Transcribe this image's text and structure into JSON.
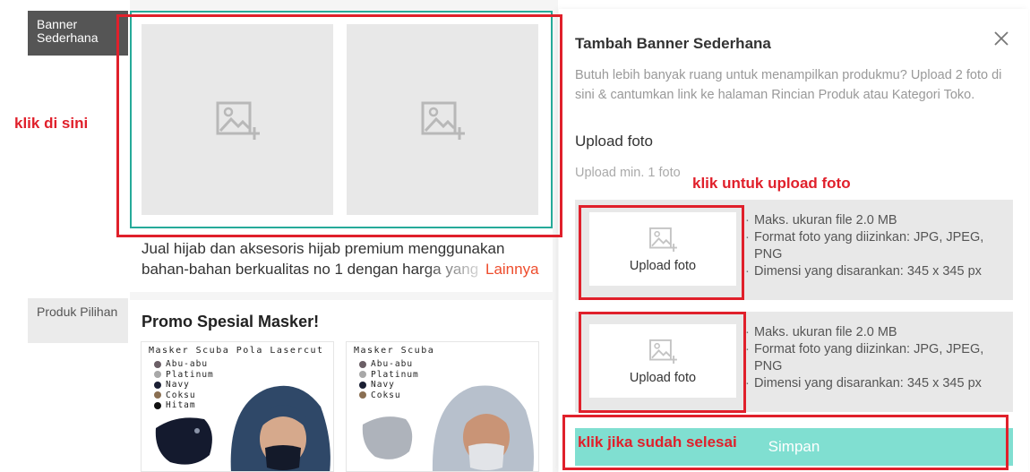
{
  "editor": {
    "tab_banner": "Banner Sederhana",
    "tab_produk": "Produk Pilihan",
    "description": "Jual hijab dan aksesoris hijab premium menggunakan bahan-bahan berkualitas no 1 dengan harga yang",
    "more_link": "Lainnya",
    "promo_title": "Promo Spesial Masker!",
    "products": [
      {
        "name": "Masker Scuba Pola Lasercut",
        "colors": [
          {
            "label": "Abu-abu",
            "hex": "#6b5f66"
          },
          {
            "label": "Platinum",
            "hex": "#a8a8a8"
          },
          {
            "label": "Navy",
            "hex": "#1b2034"
          },
          {
            "label": "Coksu",
            "hex": "#8a6f52"
          },
          {
            "label": "Hitam",
            "hex": "#111111"
          }
        ]
      },
      {
        "name": "Masker Scuba",
        "colors": [
          {
            "label": "Abu-abu",
            "hex": "#6b5f66"
          },
          {
            "label": "Platinum",
            "hex": "#a8a8a8"
          },
          {
            "label": "Navy",
            "hex": "#1b2034"
          },
          {
            "label": "Coksu",
            "hex": "#8a6f52"
          }
        ]
      }
    ]
  },
  "panel": {
    "title": "Tambah Banner Sederhana",
    "description": "Butuh lebih banyak ruang untuk menampilkan produkmu? Upload 2 foto di sini & cantumkan link ke halaman Rincian Produk atau Kategori Toko.",
    "upload_heading": "Upload foto",
    "upload_min": "Upload min. 1 foto",
    "upload_button_label": "Upload foto",
    "rules": [
      "Maks. ukuran file 2.0 MB",
      "Format foto yang diizinkan: JPG, JPEG, PNG",
      "Dimensi yang disarankan: 345 x 345 px"
    ],
    "save_label": "Simpan"
  },
  "annotations": {
    "click_here": "klik di sini",
    "click_upload": "klik untuk upload foto",
    "click_done": "klik jika sudah selesai"
  },
  "colors": {
    "accent_teal": "#26aa99",
    "save_button": "#80dfd1",
    "more_link": "#ee4d2d",
    "annotation_red": "#e0202b"
  }
}
